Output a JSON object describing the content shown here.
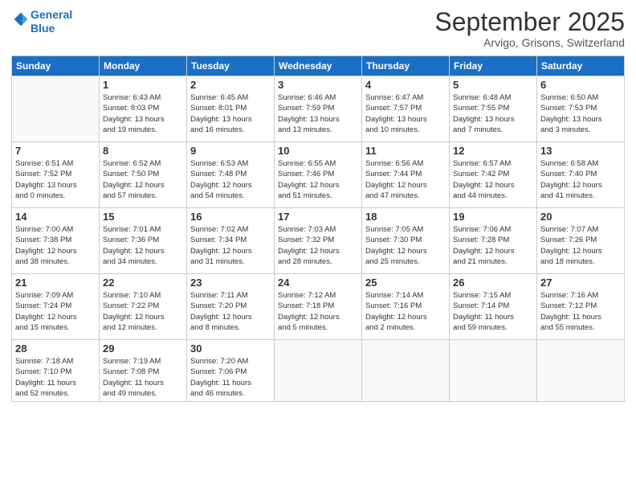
{
  "logo": {
    "line1": "General",
    "line2": "Blue"
  },
  "title": "September 2025",
  "location": "Arvigo, Grisons, Switzerland",
  "headers": [
    "Sunday",
    "Monday",
    "Tuesday",
    "Wednesday",
    "Thursday",
    "Friday",
    "Saturday"
  ],
  "weeks": [
    [
      {
        "day": "",
        "info": ""
      },
      {
        "day": "1",
        "info": "Sunrise: 6:43 AM\nSunset: 8:03 PM\nDaylight: 13 hours\nand 19 minutes."
      },
      {
        "day": "2",
        "info": "Sunrise: 6:45 AM\nSunset: 8:01 PM\nDaylight: 13 hours\nand 16 minutes."
      },
      {
        "day": "3",
        "info": "Sunrise: 6:46 AM\nSunset: 7:59 PM\nDaylight: 13 hours\nand 13 minutes."
      },
      {
        "day": "4",
        "info": "Sunrise: 6:47 AM\nSunset: 7:57 PM\nDaylight: 13 hours\nand 10 minutes."
      },
      {
        "day": "5",
        "info": "Sunrise: 6:48 AM\nSunset: 7:55 PM\nDaylight: 13 hours\nand 7 minutes."
      },
      {
        "day": "6",
        "info": "Sunrise: 6:50 AM\nSunset: 7:53 PM\nDaylight: 13 hours\nand 3 minutes."
      }
    ],
    [
      {
        "day": "7",
        "info": "Sunrise: 6:51 AM\nSunset: 7:52 PM\nDaylight: 13 hours\nand 0 minutes."
      },
      {
        "day": "8",
        "info": "Sunrise: 6:52 AM\nSunset: 7:50 PM\nDaylight: 12 hours\nand 57 minutes."
      },
      {
        "day": "9",
        "info": "Sunrise: 6:53 AM\nSunset: 7:48 PM\nDaylight: 12 hours\nand 54 minutes."
      },
      {
        "day": "10",
        "info": "Sunrise: 6:55 AM\nSunset: 7:46 PM\nDaylight: 12 hours\nand 51 minutes."
      },
      {
        "day": "11",
        "info": "Sunrise: 6:56 AM\nSunset: 7:44 PM\nDaylight: 12 hours\nand 47 minutes."
      },
      {
        "day": "12",
        "info": "Sunrise: 6:57 AM\nSunset: 7:42 PM\nDaylight: 12 hours\nand 44 minutes."
      },
      {
        "day": "13",
        "info": "Sunrise: 6:58 AM\nSunset: 7:40 PM\nDaylight: 12 hours\nand 41 minutes."
      }
    ],
    [
      {
        "day": "14",
        "info": "Sunrise: 7:00 AM\nSunset: 7:38 PM\nDaylight: 12 hours\nand 38 minutes."
      },
      {
        "day": "15",
        "info": "Sunrise: 7:01 AM\nSunset: 7:36 PM\nDaylight: 12 hours\nand 34 minutes."
      },
      {
        "day": "16",
        "info": "Sunrise: 7:02 AM\nSunset: 7:34 PM\nDaylight: 12 hours\nand 31 minutes."
      },
      {
        "day": "17",
        "info": "Sunrise: 7:03 AM\nSunset: 7:32 PM\nDaylight: 12 hours\nand 28 minutes."
      },
      {
        "day": "18",
        "info": "Sunrise: 7:05 AM\nSunset: 7:30 PM\nDaylight: 12 hours\nand 25 minutes."
      },
      {
        "day": "19",
        "info": "Sunrise: 7:06 AM\nSunset: 7:28 PM\nDaylight: 12 hours\nand 21 minutes."
      },
      {
        "day": "20",
        "info": "Sunrise: 7:07 AM\nSunset: 7:26 PM\nDaylight: 12 hours\nand 18 minutes."
      }
    ],
    [
      {
        "day": "21",
        "info": "Sunrise: 7:09 AM\nSunset: 7:24 PM\nDaylight: 12 hours\nand 15 minutes."
      },
      {
        "day": "22",
        "info": "Sunrise: 7:10 AM\nSunset: 7:22 PM\nDaylight: 12 hours\nand 12 minutes."
      },
      {
        "day": "23",
        "info": "Sunrise: 7:11 AM\nSunset: 7:20 PM\nDaylight: 12 hours\nand 8 minutes."
      },
      {
        "day": "24",
        "info": "Sunrise: 7:12 AM\nSunset: 7:18 PM\nDaylight: 12 hours\nand 5 minutes."
      },
      {
        "day": "25",
        "info": "Sunrise: 7:14 AM\nSunset: 7:16 PM\nDaylight: 12 hours\nand 2 minutes."
      },
      {
        "day": "26",
        "info": "Sunrise: 7:15 AM\nSunset: 7:14 PM\nDaylight: 11 hours\nand 59 minutes."
      },
      {
        "day": "27",
        "info": "Sunrise: 7:16 AM\nSunset: 7:12 PM\nDaylight: 11 hours\nand 55 minutes."
      }
    ],
    [
      {
        "day": "28",
        "info": "Sunrise: 7:18 AM\nSunset: 7:10 PM\nDaylight: 11 hours\nand 52 minutes."
      },
      {
        "day": "29",
        "info": "Sunrise: 7:19 AM\nSunset: 7:08 PM\nDaylight: 11 hours\nand 49 minutes."
      },
      {
        "day": "30",
        "info": "Sunrise: 7:20 AM\nSunset: 7:06 PM\nDaylight: 11 hours\nand 46 minutes."
      },
      {
        "day": "",
        "info": ""
      },
      {
        "day": "",
        "info": ""
      },
      {
        "day": "",
        "info": ""
      },
      {
        "day": "",
        "info": ""
      }
    ]
  ]
}
